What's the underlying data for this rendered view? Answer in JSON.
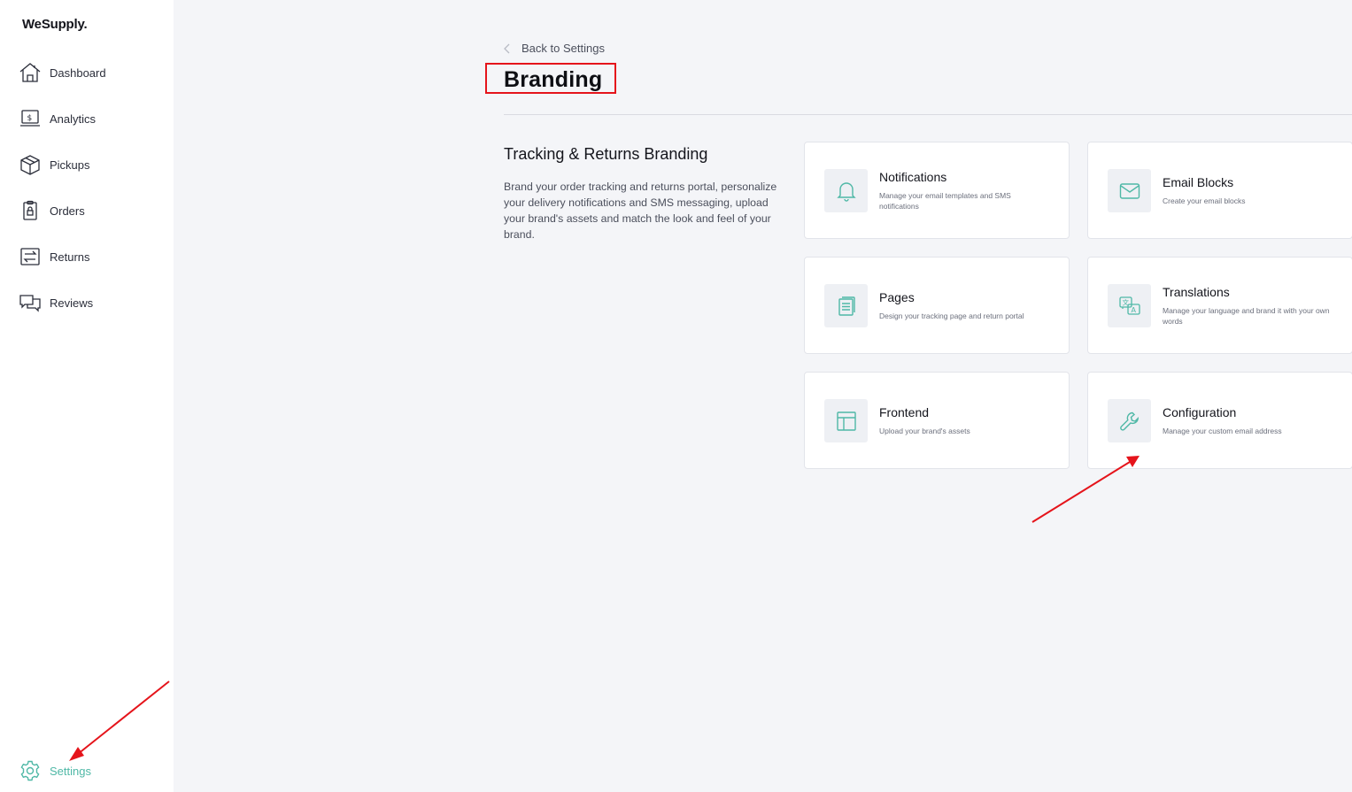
{
  "app": {
    "logo": "WeSupply."
  },
  "sidebar": {
    "items": [
      {
        "label": "Dashboard",
        "icon": "home-icon"
      },
      {
        "label": "Analytics",
        "icon": "analytics-icon"
      },
      {
        "label": "Pickups",
        "icon": "box-icon"
      },
      {
        "label": "Orders",
        "icon": "clipboard-icon"
      },
      {
        "label": "Returns",
        "icon": "returns-icon"
      },
      {
        "label": "Reviews",
        "icon": "reviews-icon"
      }
    ],
    "settings": {
      "label": "Settings",
      "icon": "gear-icon"
    }
  },
  "header": {
    "back_label": "Back to Settings",
    "title": "Branding"
  },
  "section": {
    "title": "Tracking & Returns Branding",
    "description": "Brand your order tracking and returns portal, personalize your delivery notifications and SMS messaging, upload your brand's assets and match the look and feel of your brand."
  },
  "cards": [
    {
      "title": "Notifications",
      "desc": "Manage your email templates and SMS notifications",
      "icon": "bell-icon"
    },
    {
      "title": "Email Blocks",
      "desc": "Create your email blocks",
      "icon": "envelope-icon"
    },
    {
      "title": "Pages",
      "desc": "Design your tracking page and return portal",
      "icon": "document-icon"
    },
    {
      "title": "Translations",
      "desc": "Manage your language and brand it with your own words",
      "icon": "translate-icon"
    },
    {
      "title": "Frontend",
      "desc": "Upload your brand's assets",
      "icon": "layout-icon"
    },
    {
      "title": "Configuration",
      "desc": "Manage your custom email address",
      "icon": "wrench-icon"
    }
  ],
  "colors": {
    "accent": "#4fb8a6",
    "annotation": "#e5141b",
    "background": "#f4f5f8"
  }
}
